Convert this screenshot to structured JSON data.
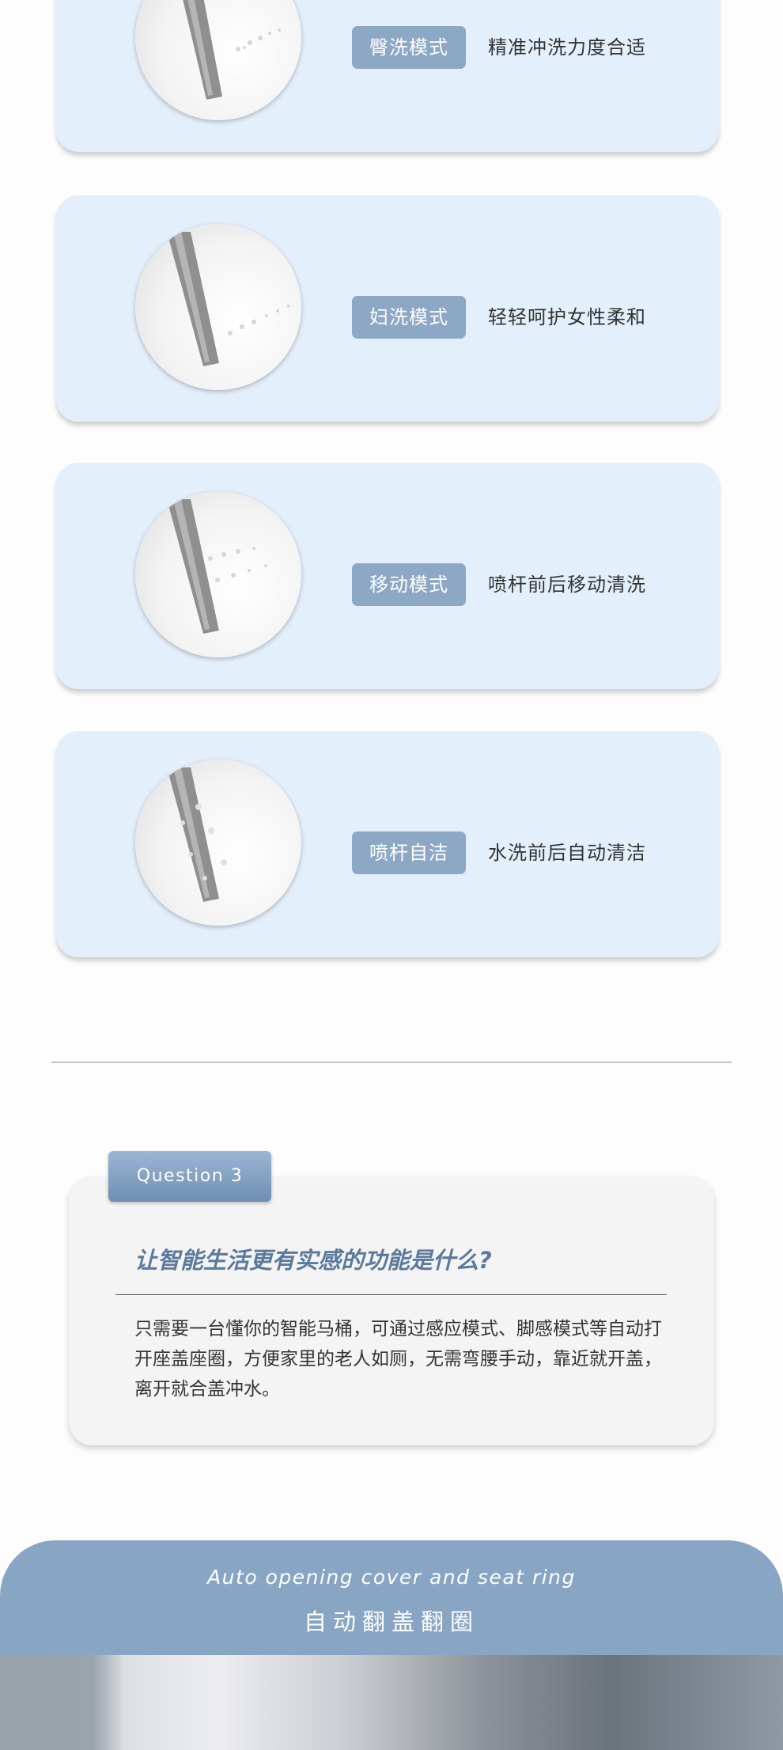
{
  "modes": [
    {
      "tag": "臀洗模式",
      "desc": "精准冲洗力度合适",
      "icon": "bidet-nozzle-rear-wash"
    },
    {
      "tag": "妇洗模式",
      "desc": "轻轻呵护女性柔和",
      "icon": "bidet-nozzle-feminine-wash"
    },
    {
      "tag": "移动模式",
      "desc": "喷杆前后移动清洗",
      "icon": "bidet-nozzle-oscillating-wash"
    },
    {
      "tag": "喷杆自洁",
      "desc": "水洗前后自动清洁",
      "icon": "bidet-nozzle-self-clean"
    }
  ],
  "question": {
    "tab": "Question 3",
    "title": "让智能生活更有实感的功能是什么?",
    "body": "只需要一台懂你的智能马桶，可通过感应模式、脚感模式等自动打开座盖座圈，方便家里的老人如厕，无需弯腰手动，靠近就开盖，离开就合盖冲水。"
  },
  "banner": {
    "title_en": "Auto opening cover and seat ring",
    "title_cn": "自动翻盖翻圈"
  },
  "colors": {
    "card_bg": "#e3effb",
    "tag_bg": "#8da8c5",
    "accent": "#5c7a9b",
    "banner_bg": "#88a6c4"
  }
}
